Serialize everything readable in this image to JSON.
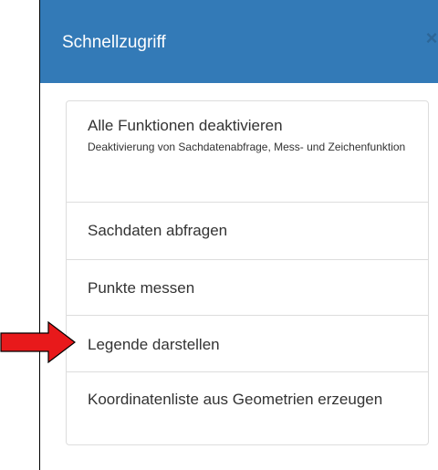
{
  "dialog": {
    "title": "Schnellzugriff",
    "close_symbol": "×",
    "header_color": "#337ab7"
  },
  "items": [
    {
      "label": "Alle Funktionen deaktivieren",
      "description": "Deaktivierung von Sachdatenabfrage, Mess- und Zeichenfunktion"
    },
    {
      "label": "Sachdaten abfragen"
    },
    {
      "label": "Punkte messen"
    },
    {
      "label": "Legende darstellen"
    },
    {
      "label": "Koordinatenliste aus Geometrien erzeugen"
    }
  ],
  "annotation": {
    "icon": "red-arrow-right",
    "color": "#e8191b",
    "points_to": "Legende darstellen"
  }
}
